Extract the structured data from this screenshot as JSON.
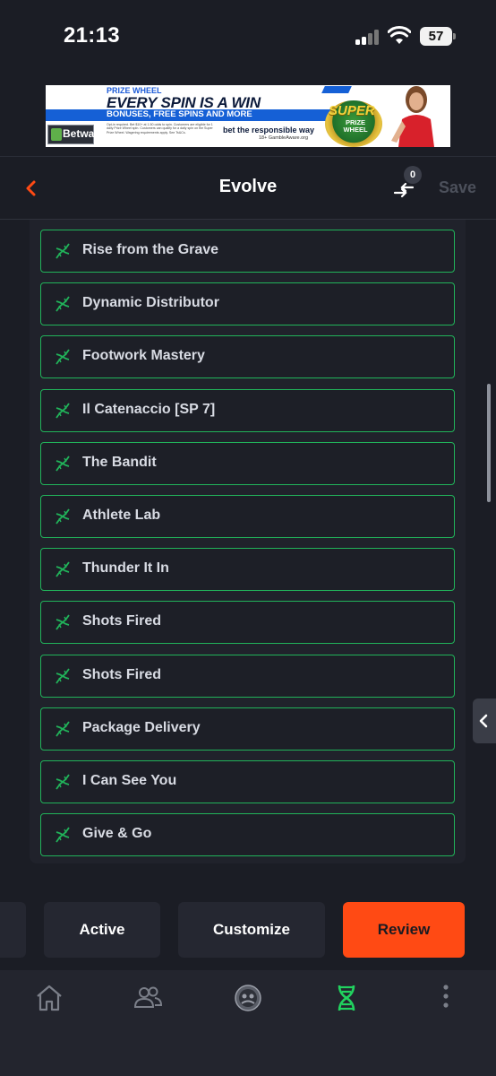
{
  "status_bar": {
    "time": "21:13",
    "battery": "57"
  },
  "ad": {
    "prize_label": "PRIZE WHEEL",
    "headline": "EVERY SPIN IS A WIN",
    "subline": "BONUSES, FREE SPINS AND MORE",
    "fine_print": "Opt-in required. Bet $10+ at 1.50 odds to spin. Customers are eligible for 1 daily Prize Wheel spin. Customers can qualify for a daily spin on the Super Prize Wheel. Wagering requirements apply. See Ts&Cs.",
    "brand": "Betway",
    "responsible": "bet the responsible way",
    "gamble_aware": "18+ GambleAware.org",
    "wheel_super": "SUPER",
    "wheel_label": "PRIZE WHEEL"
  },
  "header": {
    "title": "Evolve",
    "swap_count": "0",
    "save_label": "Save"
  },
  "items": [
    {
      "label": "Rise from the Grave"
    },
    {
      "label": "Dynamic Distributor"
    },
    {
      "label": "Footwork Mastery"
    },
    {
      "label": "Il Catenaccio [SP 7]"
    },
    {
      "label": "The Bandit"
    },
    {
      "label": "Athlete Lab"
    },
    {
      "label": "Thunder It In"
    },
    {
      "label": "Shots Fired"
    },
    {
      "label": "Shots Fired"
    },
    {
      "label": "Package Delivery"
    },
    {
      "label": "I Can See You"
    },
    {
      "label": "Give & Go"
    }
  ],
  "actions": {
    "active": "Active",
    "customize": "Customize",
    "review": "Review"
  },
  "colors": {
    "accent_green": "#21b35a",
    "review_orange": "#ff4a14",
    "back_arrow": "#ff4a14"
  },
  "tabs": [
    {
      "name": "home-icon"
    },
    {
      "name": "people-icon"
    },
    {
      "name": "team-badge-icon"
    },
    {
      "name": "dna-icon",
      "active": true
    },
    {
      "name": "more-icon"
    }
  ]
}
